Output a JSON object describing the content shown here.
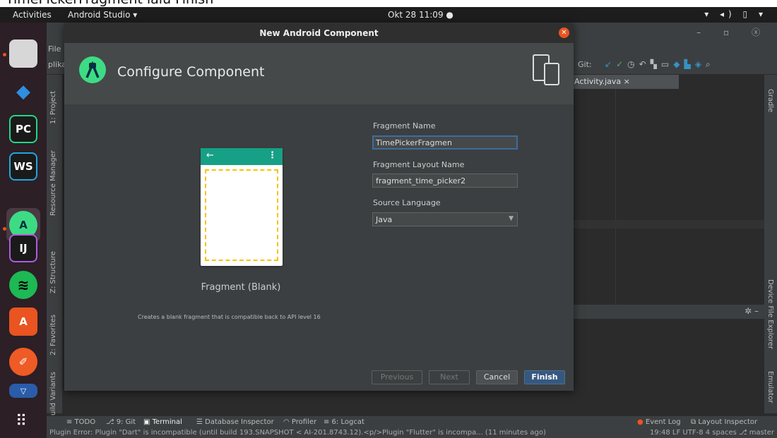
{
  "caption": "TimePickerFragment lalu Finish",
  "topbar": {
    "activities": "Activities",
    "app": "Android Studio ▾",
    "clock": "Okt 28 11:09 ●",
    "tray": "▾ ◂) ▯ ▾"
  },
  "dock": {
    "apps": [
      {
        "name": "files",
        "label": ""
      },
      {
        "name": "vscode",
        "label": "◆"
      },
      {
        "name": "pycharm",
        "label": "PC"
      },
      {
        "name": "webstorm",
        "label": "WS"
      },
      {
        "name": "android-studio",
        "label": "A"
      },
      {
        "name": "intellij",
        "label": "IJ"
      },
      {
        "name": "spotify",
        "label": "≋"
      },
      {
        "name": "software",
        "label": "A"
      },
      {
        "name": "postman",
        "label": "✐"
      },
      {
        "name": "unknown",
        "label": "▽"
      }
    ],
    "apps_grid": "⠿"
  },
  "ide": {
    "menu_file": "File",
    "project_label": "plika",
    "git_label": "Git:",
    "editor_tab": "Activity.java ×",
    "left_tools": [
      "1: Project",
      "Resource Manager",
      "Z: Structure",
      "2: Favorites",
      "Build Variants"
    ],
    "right_tools": [
      "Gradle",
      "Device File Explorer",
      "Emulator"
    ],
    "tool_windows": [
      "≡ TODO",
      "⎇ 9: Git",
      "▣ Terminal",
      "☰ Database Inspector",
      "◠ Profiler",
      "≡ 6: Logcat"
    ],
    "event_log": "Event Log",
    "layout_inspector": "Layout Inspector",
    "status_message": "Plugin Error: Plugin \"Dart\" is incompatible (until build 193.SNAPSHOT < AI-201.8743.12).<p/>Plugin \"Flutter\" is incompa... (11 minutes ago)",
    "status_right": "19:48  LF  UTF-8  4 spaces  ⎇ master"
  },
  "dialog": {
    "title": "New Android Component",
    "heading": "Configure Component",
    "preview_name": "Fragment (Blank)",
    "preview_description": "Creates a blank fragment that is compatible back to API level 16",
    "fields": {
      "fragment_name_label": "Fragment Name",
      "fragment_name_value": "TimePickerFragmen",
      "layout_name_label": "Fragment Layout Name",
      "layout_name_value": "fragment_time_picker2",
      "language_label": "Source Language",
      "language_value": "Java"
    },
    "buttons": {
      "previous": "Previous",
      "next": "Next",
      "cancel": "Cancel",
      "finish": "Finish"
    }
  },
  "colors": {
    "accent": "#365880",
    "ubuntu_orange": "#e95420",
    "preview_toolbar": "#16a085"
  }
}
